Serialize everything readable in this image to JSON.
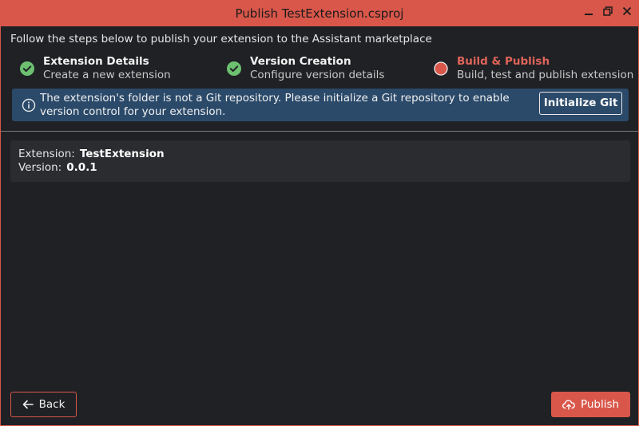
{
  "window": {
    "title": "Publish TestExtension.csproj",
    "controls": [
      "minimize-icon",
      "restore-icon",
      "close-icon"
    ]
  },
  "intro": "Follow the steps below to publish your extension to the Assistant marketplace",
  "steps": [
    {
      "title": "Extension Details",
      "subtitle": "Create a new extension",
      "status": "complete"
    },
    {
      "title": "Version Creation",
      "subtitle": "Configure version details",
      "status": "complete"
    },
    {
      "title": "Build & Publish",
      "subtitle": "Build, test and publish extension",
      "status": "active"
    }
  ],
  "banner": {
    "icon": "info-icon",
    "message": "The extension's folder is not a Git repository. Please initialize a Git repository to enable version control for your extension.",
    "button_label": "Initialize Git"
  },
  "details": {
    "extension_label": "Extension:",
    "extension_value": "TestExtension",
    "version_label": "Version:",
    "version_value": "0.0.1"
  },
  "footer": {
    "back_label": "Back",
    "back_icon": "arrow-left-icon",
    "publish_label": "Publish",
    "publish_icon": "cloud-upload-icon"
  },
  "colors": {
    "accent": "#d9574a",
    "background": "#1f2124",
    "banner": "#2b4a6a",
    "success": "#6cc070"
  }
}
